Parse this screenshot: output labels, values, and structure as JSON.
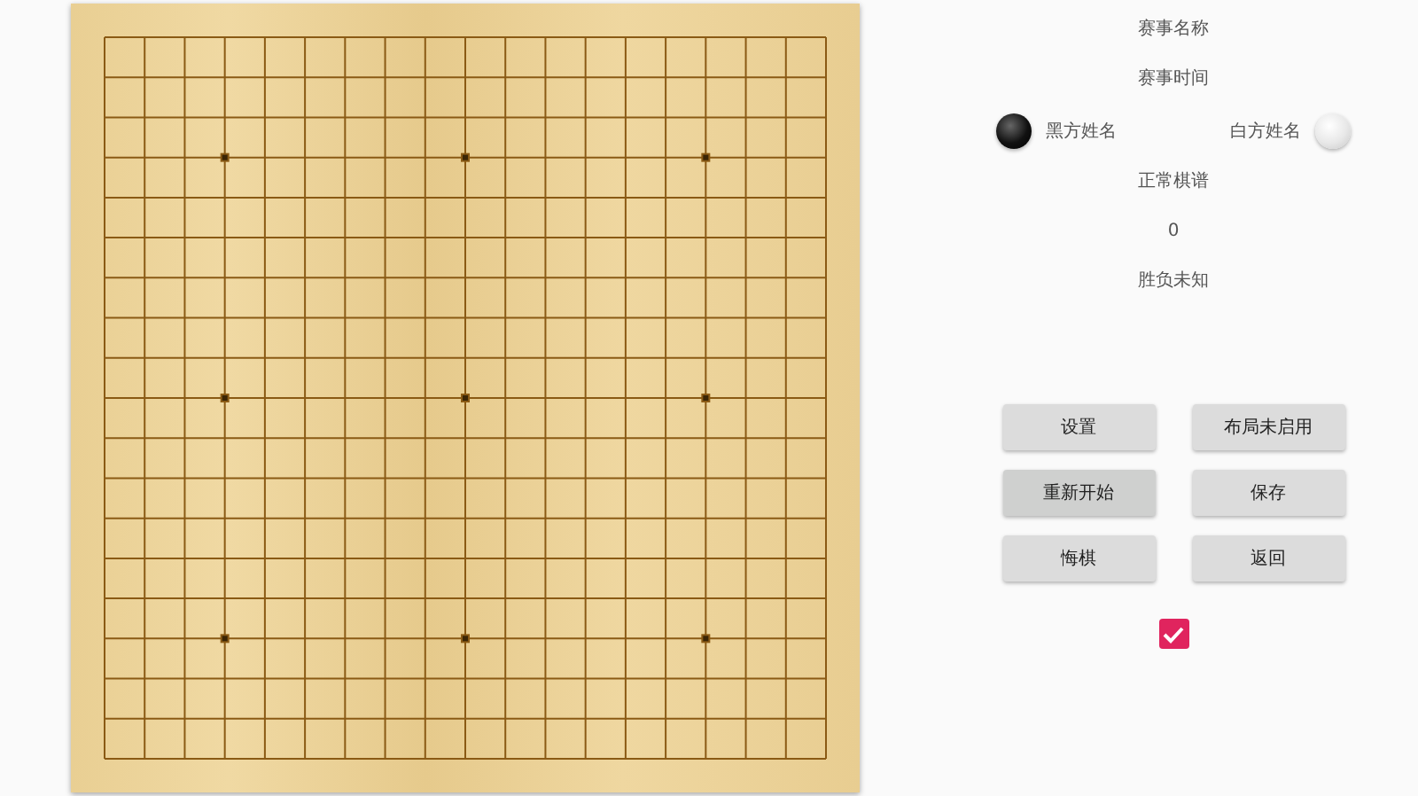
{
  "match": {
    "name": "赛事名称",
    "time": "赛事时间"
  },
  "players": [
    {
      "kind": "black",
      "name": "黑方姓名"
    },
    {
      "kind": "white",
      "name": "白方姓名"
    }
  ],
  "record_type": "正常棋谱",
  "move_count": "0",
  "result": "胜负未知",
  "buttons": [
    {
      "label": "设置",
      "pressed": false
    },
    {
      "label": "布局未启用",
      "pressed": false
    },
    {
      "label": "重新开始",
      "pressed": true
    },
    {
      "label": "保存",
      "pressed": false
    },
    {
      "label": "悔棋",
      "pressed": false
    },
    {
      "label": "返回",
      "pressed": false
    }
  ],
  "checkbox": {
    "checked": true
  }
}
